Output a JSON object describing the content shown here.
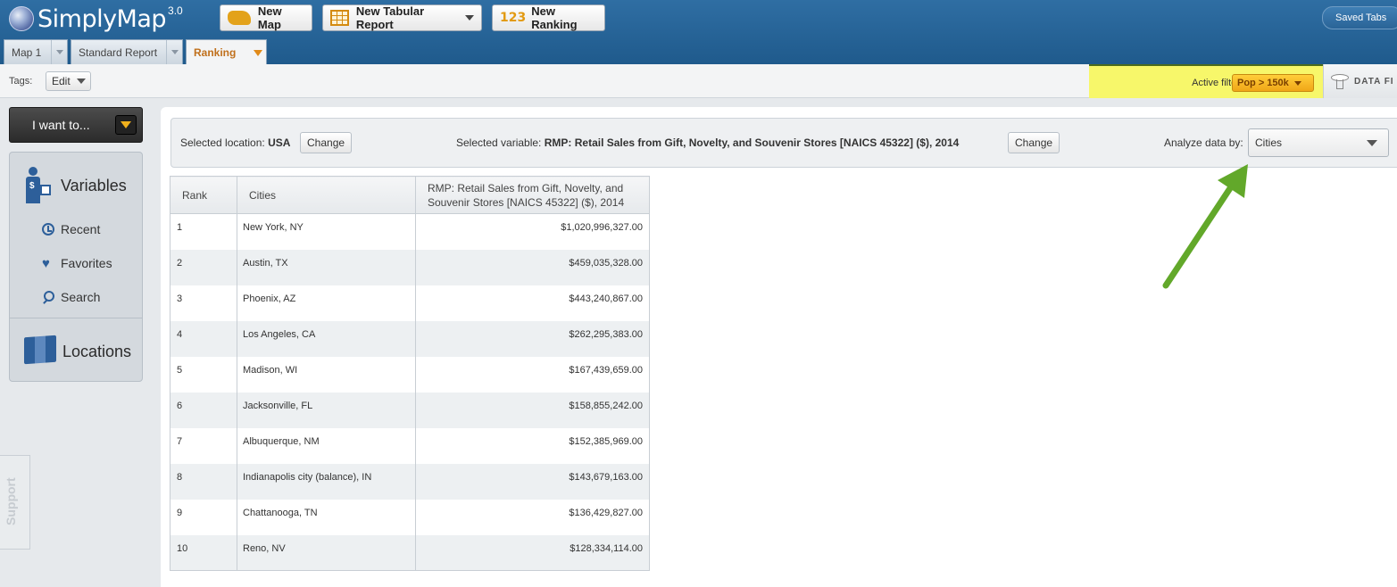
{
  "header": {
    "logo_text": "SimplyMap",
    "logo_version": "3.0",
    "buttons": {
      "new_map": "New Map",
      "new_tabular_report": "New Tabular Report",
      "new_ranking_prefix": "123",
      "new_ranking": "New Ranking"
    },
    "saved_tabs": "Saved Tabs"
  },
  "tabs": [
    {
      "label": "Map 1",
      "active": false
    },
    {
      "label": "Standard Report",
      "active": false
    },
    {
      "label": "Ranking",
      "active": true
    }
  ],
  "toolbar": {
    "tags_label": "Tags:",
    "edit_label": "Edit",
    "active_filter_label": "Active filter:",
    "active_filter_value": "Pop > 150k",
    "data_filter_label": "DATA FI"
  },
  "sidebar": {
    "i_want_to": "I want to...",
    "variables_title": "Variables",
    "links": [
      {
        "label": "Recent",
        "icon": "clock-icon"
      },
      {
        "label": "Favorites",
        "icon": "heart-icon"
      },
      {
        "label": "Search",
        "icon": "search-icon"
      }
    ],
    "locations_title": "Locations",
    "support": "Support"
  },
  "selection": {
    "location_label": "Selected location:",
    "location_value": "USA",
    "change_label": "Change",
    "variable_label": "Selected variable:",
    "variable_value": "RMP: Retail Sales from Gift, Novelty, and Souvenir Stores [NAICS 45322] ($), 2014",
    "analyze_label": "Analyze data by:",
    "analyze_value": "Cities"
  },
  "table": {
    "columns": [
      "Rank",
      "Cities",
      "RMP: Retail Sales from Gift, Novelty, and Souvenir Stores [NAICS 45322] ($), 2014"
    ],
    "rows": [
      {
        "rank": "1",
        "city": "New York, NY",
        "value": "$1,020,996,327.00"
      },
      {
        "rank": "2",
        "city": "Austin, TX",
        "value": "$459,035,328.00"
      },
      {
        "rank": "3",
        "city": "Phoenix, AZ",
        "value": "$443,240,867.00"
      },
      {
        "rank": "4",
        "city": "Los Angeles, CA",
        "value": "$262,295,383.00"
      },
      {
        "rank": "5",
        "city": "Madison, WI",
        "value": "$167,439,659.00"
      },
      {
        "rank": "6",
        "city": "Jacksonville, FL",
        "value": "$158,855,242.00"
      },
      {
        "rank": "7",
        "city": "Albuquerque, NM",
        "value": "$152,385,969.00"
      },
      {
        "rank": "8",
        "city": "Indianapolis city (balance), IN",
        "value": "$143,679,163.00"
      },
      {
        "rank": "9",
        "city": "Chattanooga, TN",
        "value": "$136,429,827.00"
      },
      {
        "rank": "10",
        "city": "Reno, NV",
        "value": "$128,334,114.00"
      }
    ]
  },
  "colors": {
    "header_blue": "#1f5a8c",
    "highlight_yellow": "#f7f76a",
    "filter_orange": "#f0a617",
    "annotation_green": "#62a82a"
  }
}
